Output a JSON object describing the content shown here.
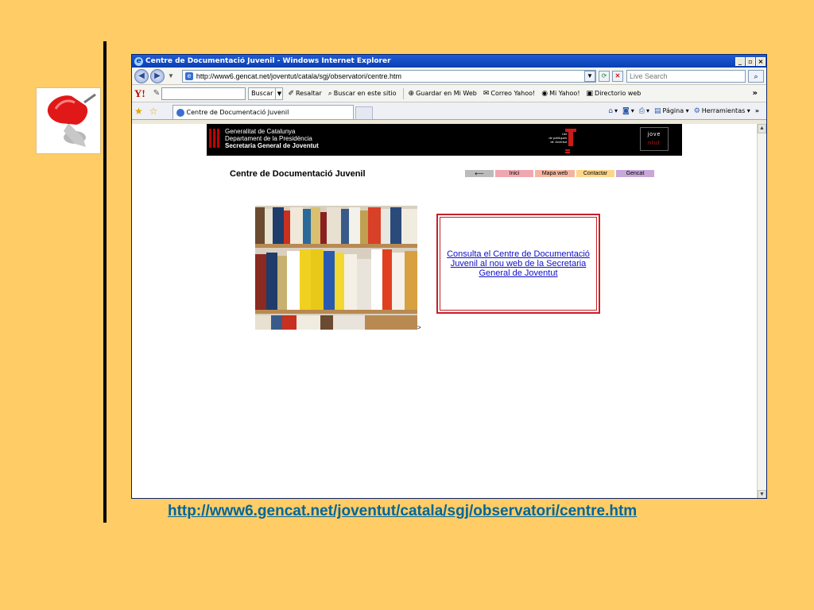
{
  "window": {
    "title": "Centre de Documentació Juvenil - Windows Internet Explorer",
    "minimize": "_",
    "maximize": "▫",
    "close": "×"
  },
  "address": {
    "url": "http://www6.gencat.net/joventut/catala/sgj/observatori/centre.htm",
    "search_placeholder": "Live Search"
  },
  "yahoo": {
    "logo": "Y!",
    "search_button": "Buscar",
    "items": [
      "Resaltar",
      "Buscar en este sitio",
      "Guardar en Mi Web",
      "Correo Yahoo!",
      "Mi Yahoo!",
      "Directorio web"
    ]
  },
  "tabs": {
    "active": "Centre de Documentació Juvenil"
  },
  "commands": {
    "page": "Página",
    "tools": "Herramientas"
  },
  "banner": {
    "line1": "Generalitat de Catalunya",
    "line2": "Departament de la Presidència",
    "line3": "Secretaria General de Joventut",
    "lleis_text1": "Llei",
    "lleis_text2": "de polítiques",
    "lleis_text3": "de Joventut",
    "joventut_line1": "jove",
    "joventut_line2": "ntut"
  },
  "page": {
    "title": "Centre de Documentació Juvenil",
    "nav": [
      "Inici",
      "Mapa web",
      "Contactar",
      "Gencat"
    ],
    "notice_link": "Consulta el Centre de Documentació Juvenil al nou web de la Secretaria General de Joventut",
    "stray_char": ">"
  },
  "footer_link": "http://www6.gencat.net/joventut/catala/sgj/observatori/centre.htm",
  "colors": {
    "slide_background": "#ffcc66",
    "link_blue": "#1010c8",
    "notice_border": "#c81e28",
    "footer_link": "#00669a"
  },
  "icons": [
    "pushpin-icon",
    "ie-icon",
    "back-arrow-icon",
    "forward-arrow-icon",
    "refresh-icon",
    "stop-icon",
    "search-icon",
    "star-icon",
    "home-icon",
    "rss-icon",
    "print-icon"
  ]
}
